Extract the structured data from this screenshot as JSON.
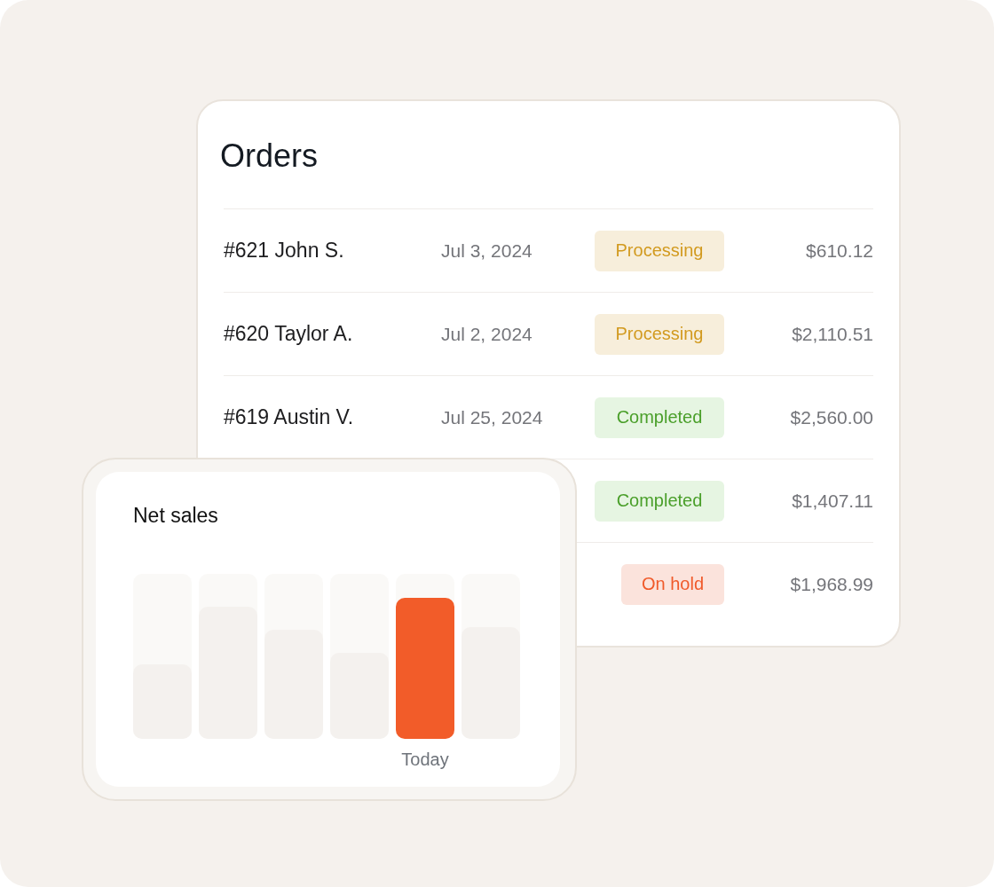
{
  "orders": {
    "title": "Orders",
    "rows": [
      {
        "name": "#621 John S.",
        "date": "Jul 3, 2024",
        "status": "Processing",
        "kind": "processing",
        "amount": "$610.12"
      },
      {
        "name": "#620 Taylor A.",
        "date": "Jul 2, 2024",
        "status": "Processing",
        "kind": "processing",
        "amount": "$2,110.51"
      },
      {
        "name": "#619 Austin V.",
        "date": "Jul 25, 2024",
        "status": "Completed",
        "kind": "completed",
        "amount": "$2,560.00"
      },
      {
        "status": "Completed",
        "kind": "completed",
        "amount": "$1,407.11"
      },
      {
        "status": "On hold",
        "kind": "on_hold",
        "amount": "$1,968.99"
      }
    ]
  },
  "net_sales": {
    "title": "Net sales",
    "bars": [
      {
        "selected": false
      },
      {
        "selected": false
      },
      {
        "selected": false
      },
      {
        "selected": false
      },
      {
        "selected": true,
        "label": "Today"
      },
      {
        "selected": false
      }
    ]
  }
}
